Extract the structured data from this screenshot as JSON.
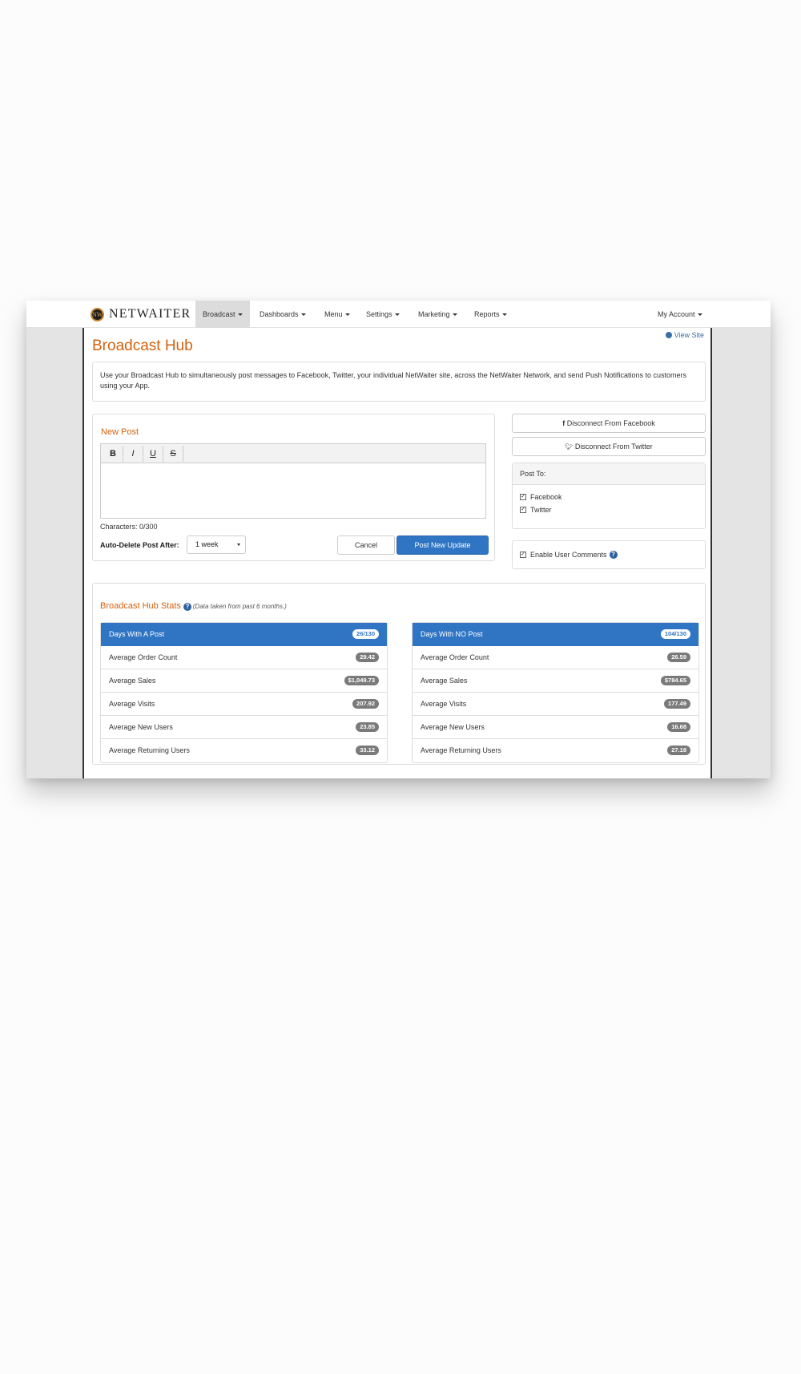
{
  "brand": {
    "name": "NETWAITER",
    "logo_text": "NW"
  },
  "nav": {
    "items": [
      "Broadcast",
      "Dashboards",
      "Menu",
      "Settings",
      "Marketing",
      "Reports"
    ],
    "account": "My Account"
  },
  "page": {
    "title": "Broadcast Hub",
    "view_site": "View Site",
    "intro": "Use your Broadcast Hub to simultaneously post messages to Facebook, Twitter, your individual NetWaiter site, across the NetWaiter Network, and send Push Notifications to customers using your App."
  },
  "new_post": {
    "title": "New Post",
    "toolbar": [
      "B",
      "I",
      "U",
      "S"
    ],
    "characters": "Characters: 0/300",
    "auto_delete_label": "Auto-Delete Post After:",
    "auto_delete_value": "1 week",
    "cancel": "Cancel",
    "submit": "Post New Update"
  },
  "social": {
    "disconnect_facebook": "Disconnect From Facebook",
    "disconnect_twitter": "Disconnect From Twitter",
    "post_to_label": "Post To:",
    "targets": [
      "Facebook",
      "Twitter"
    ],
    "enable_comments": "Enable User Comments",
    "help_glyph": "?"
  },
  "stats": {
    "title": "Broadcast Hub Stats",
    "note": "(Data taken from past 6 months.)",
    "with_post": {
      "header": "Days With A Post",
      "header_badge": "26/130",
      "rows": [
        {
          "label": "Average Order Count",
          "value": "29.42"
        },
        {
          "label": "Average Sales",
          "value": "$1,049.73"
        },
        {
          "label": "Average Visits",
          "value": "207.92"
        },
        {
          "label": "Average New Users",
          "value": "23.85"
        },
        {
          "label": "Average Returning Users",
          "value": "33.12"
        }
      ]
    },
    "no_post": {
      "header": "Days With NO Post",
      "header_badge": "104/130",
      "rows": [
        {
          "label": "Average Order Count",
          "value": "26.59"
        },
        {
          "label": "Average Sales",
          "value": "$784.65"
        },
        {
          "label": "Average Visits",
          "value": "177.49"
        },
        {
          "label": "Average New Users",
          "value": "16.68"
        },
        {
          "label": "Average Returning Users",
          "value": "27.18"
        }
      ]
    }
  },
  "colors": {
    "accent": "#d4620f",
    "primary": "#2f75c4",
    "badge": "#7a7a7a"
  }
}
